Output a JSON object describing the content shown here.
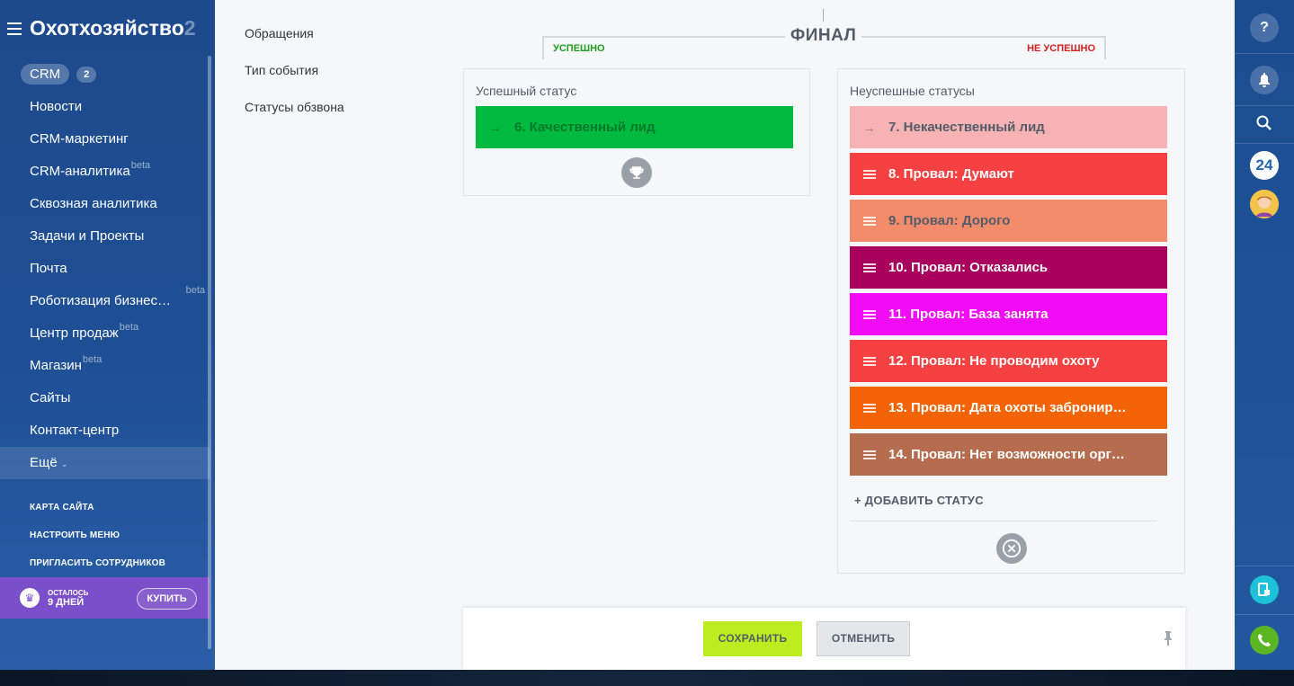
{
  "sidebar": {
    "title": "Охотхозяйство",
    "title_fade": "2",
    "crm_label": "CRM",
    "crm_count": "2",
    "items": [
      {
        "label": "Новости"
      },
      {
        "label": "CRM-маркетинг"
      },
      {
        "label": "CRM-аналитика",
        "beta": "beta"
      },
      {
        "label": "Сквозная аналитика"
      },
      {
        "label": "Задачи и Проекты"
      },
      {
        "label": "Почта"
      },
      {
        "label": "Роботизация бизнес…",
        "beta_right": "beta"
      },
      {
        "label": "Центр продаж",
        "beta": "beta"
      },
      {
        "label": "Магазин",
        "beta": "beta"
      },
      {
        "label": "Сайты"
      },
      {
        "label": "Контакт-центр"
      },
      {
        "label": "Ещё"
      }
    ],
    "links": [
      "КАРТА САЙТА",
      "НАСТРОИТЬ МЕНЮ",
      "ПРИГЛАСИТЬ СОТРУДНИКОВ"
    ],
    "trial": {
      "line1": "ОСТАЛОСЬ",
      "line2": "9 ДНЕЙ",
      "buy": "КУПИТЬ"
    }
  },
  "settings_menu": {
    "items": [
      "Обращения",
      "Тип события",
      "Статусы обзвона"
    ]
  },
  "final": {
    "title": "ФИНАЛ",
    "success_label": "УСПЕШНО",
    "fail_label": "НЕ УСПЕШНО"
  },
  "success_panel": {
    "title": "Успешный статус",
    "status": {
      "label": "6. Качественный лид",
      "color": "#00b93f"
    }
  },
  "fail_panel": {
    "title": "Неуспешные статусы",
    "statuses": [
      {
        "label": "7. Некачественный лид",
        "color": "#f7b3b3",
        "text_color": "#535c69",
        "icon": "arrow"
      },
      {
        "label": "8. Провал: Думают",
        "color": "#f54141",
        "text_color": "#ffffff",
        "icon": "drag"
      },
      {
        "label": "9. Провал: Дорого",
        "color": "#f28c6b",
        "text_color": "#535c69",
        "icon": "drag"
      },
      {
        "label": "10. Провал: Отказались",
        "color": "#a8005c",
        "text_color": "#ffffff",
        "icon": "drag"
      },
      {
        "label": "11. Провал: База занята",
        "color": "#f20bf5",
        "text_color": "#ffffff",
        "icon": "drag"
      },
      {
        "label": "12. Провал: Не проводим охоту",
        "color": "#f54141",
        "text_color": "#ffffff",
        "icon": "drag"
      },
      {
        "label": "13. Провал: Дата охоты забронир…",
        "color": "#f26406",
        "text_color": "#ffffff",
        "icon": "drag"
      },
      {
        "label": "14. Провал: Нет возможности орг…",
        "color": "#b56c4f",
        "text_color": "#ffffff",
        "icon": "drag"
      }
    ],
    "add_status": "+ ДОБАВИТЬ СТАТУС"
  },
  "footer": {
    "save": "СОХРАНИТЬ",
    "cancel": "ОТМЕНИТЬ"
  },
  "right_rail": {
    "help": "?",
    "b24": "24"
  }
}
